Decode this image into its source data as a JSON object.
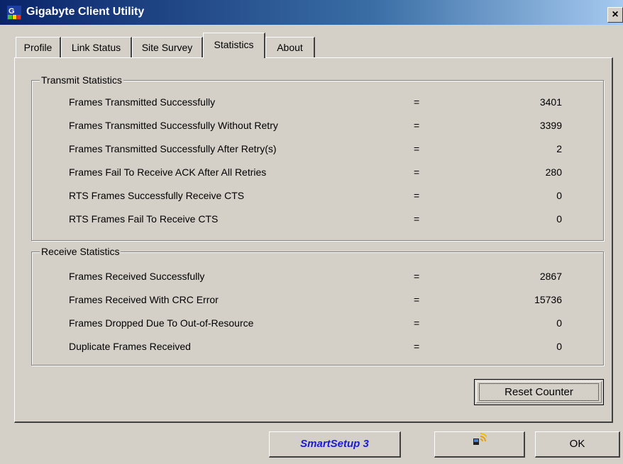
{
  "window": {
    "title": "Gigabyte Client Utility",
    "close_label": "×"
  },
  "tabs": [
    {
      "label": "Profile",
      "active": false
    },
    {
      "label": "Link Status",
      "active": false
    },
    {
      "label": "Site Survey",
      "active": false
    },
    {
      "label": "Statistics",
      "active": true
    },
    {
      "label": "About",
      "active": false
    }
  ],
  "transmit": {
    "title": "Transmit Statistics",
    "rows": [
      {
        "label": "Frames Transmitted Successfully",
        "eq": "=",
        "value": "3401"
      },
      {
        "label": "Frames Transmitted Successfully  Without Retry",
        "eq": "=",
        "value": "3399"
      },
      {
        "label": "Frames Transmitted Successfully After Retry(s)",
        "eq": "=",
        "value": "2"
      },
      {
        "label": "Frames Fail To Receive ACK After All Retries",
        "eq": "=",
        "value": "280"
      },
      {
        "label": "RTS Frames Successfully Receive CTS",
        "eq": "=",
        "value": "0"
      },
      {
        "label": "RTS Frames Fail To Receive CTS",
        "eq": "=",
        "value": "0"
      }
    ]
  },
  "receive": {
    "title": "Receive Statistics",
    "rows": [
      {
        "label": "Frames Received Successfully",
        "eq": "=",
        "value": "2867"
      },
      {
        "label": "Frames Received With CRC Error",
        "eq": "=",
        "value": "15736"
      },
      {
        "label": "Frames Dropped Due To Out-of-Resource",
        "eq": "=",
        "value": "0"
      },
      {
        "label": "Duplicate Frames Received",
        "eq": "=",
        "value": "0"
      }
    ]
  },
  "buttons": {
    "reset": "Reset Counter",
    "smartsetup": "SmartSetup 3",
    "wireless_icon": "wireless-signal-icon",
    "ok": "OK"
  },
  "colors": {
    "titlebar_start": "#0a246a",
    "titlebar_end": "#a6caf0",
    "smartsetup_text": "#1a1ad8",
    "face": "#d4d0c8"
  }
}
